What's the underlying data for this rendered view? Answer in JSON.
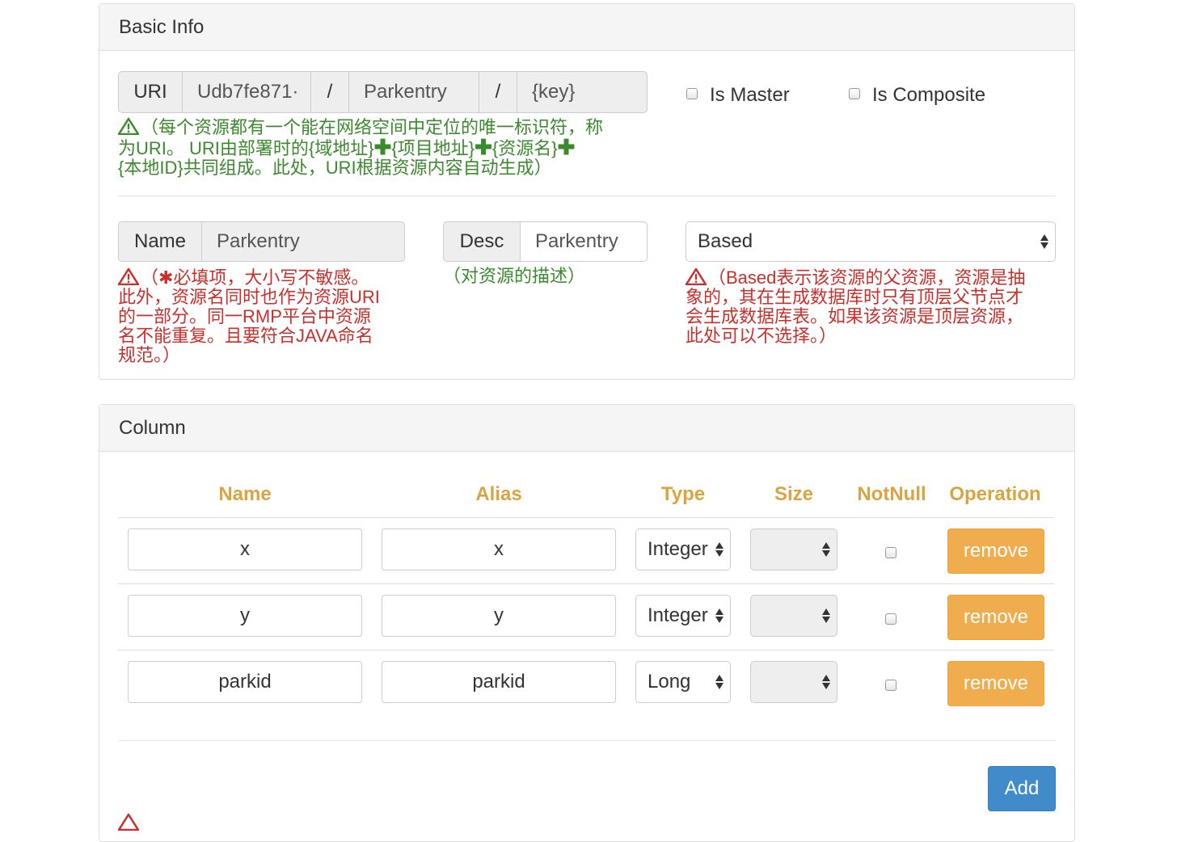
{
  "basic_info": {
    "title": "Basic Info",
    "uri": {
      "label": "URI",
      "segment1": "Udb7fe871·",
      "sep1": "/",
      "segment2": "Parkentry",
      "sep2": "/",
      "segment3": "{key}",
      "hint_line1": "（每个资源都有一个能在网络空间中定位的唯一标识符，称",
      "hint_line2a": "为URI。  URI由部署时的{域地址}",
      "hint_line2b": "{项目地址}",
      "hint_line2c": "{资源名}",
      "hint_line3": "{本地ID}共同组成。此处，URI根据资源内容自动生成）",
      "plus": "✚"
    },
    "is_master_label": "Is Master",
    "is_composite_label": "Is Composite",
    "name": {
      "label": "Name",
      "value": "Parkentry",
      "hint_line1": "（✱必填项，大小写不敏感。",
      "hint_line2": "此外，资源名同时也作为资源URI",
      "hint_line3": "的一部分。同一RMP平台中资源",
      "hint_line4": "名不能重复。且要符合JAVA命名",
      "hint_line5": "规范。）"
    },
    "desc": {
      "label": "Desc",
      "value": "Parkentry",
      "hint": "（对资源的描述）"
    },
    "based": {
      "selected": "Based",
      "hint_line1": "（Based表示该资源的父资源，资源是抽",
      "hint_line2": "象的，其在生成数据库时只有顶层父节点才",
      "hint_line3": "会生成数据库表。如果该资源是顶层资源，",
      "hint_line4": "此处可以不选择。）"
    }
  },
  "column": {
    "title": "Column",
    "headers": {
      "name": "Name",
      "alias": "Alias",
      "type": "Type",
      "size": "Size",
      "notnull": "NotNull",
      "operation": "Operation"
    },
    "rows": [
      {
        "name": "x",
        "alias": "x",
        "type": "Integer",
        "size": "",
        "notnull": false,
        "action": "remove"
      },
      {
        "name": "y",
        "alias": "y",
        "type": "Integer",
        "size": "",
        "notnull": false,
        "action": "remove"
      },
      {
        "name": "parkid",
        "alias": "parkid",
        "type": "Long",
        "size": "",
        "notnull": false,
        "action": "remove"
      }
    ],
    "add_label": "Add"
  },
  "colors": {
    "header_gold": "#d9a441",
    "hint_green": "#3c8a2e",
    "hint_red": "#c9302c",
    "remove_orange": "#f0ad4e",
    "add_blue": "#428bca"
  },
  "icons": [
    "warning-triangle-icon",
    "plus-icon",
    "select-arrows-icon"
  ]
}
